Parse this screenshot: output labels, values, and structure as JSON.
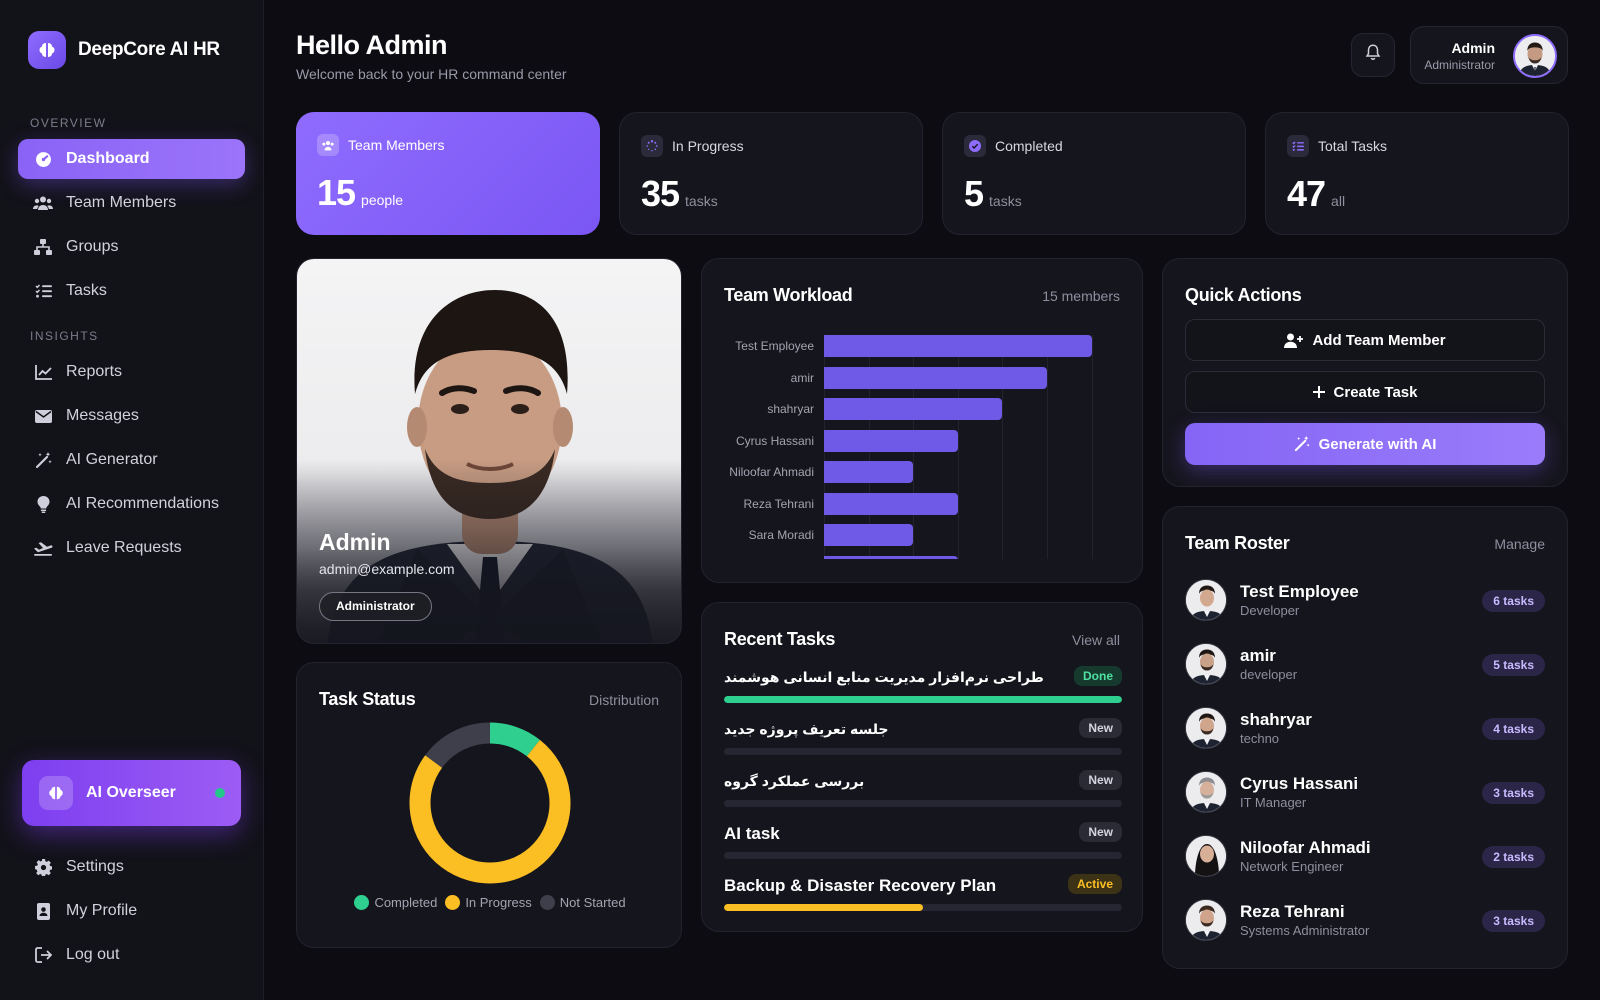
{
  "brand": {
    "name": "DeepCore AI HR"
  },
  "sidebar": {
    "section_overview": "OVERVIEW",
    "section_insights": "INSIGHTS",
    "items": [
      {
        "label": "Dashboard",
        "icon": "dashboard-icon"
      },
      {
        "label": "Team Members",
        "icon": "users-icon"
      },
      {
        "label": "Groups",
        "icon": "sitemap-icon"
      },
      {
        "label": "Tasks",
        "icon": "tasks-icon"
      },
      {
        "label": "Reports",
        "icon": "chart-line-icon"
      },
      {
        "label": "Messages",
        "icon": "envelope-icon"
      },
      {
        "label": "AI Generator",
        "icon": "magic-wand-icon"
      },
      {
        "label": "AI Recommendations",
        "icon": "lightbulb-icon"
      },
      {
        "label": "Leave Requests",
        "icon": "plane-icon"
      }
    ],
    "overseer": {
      "label": "AI Overseer"
    },
    "bottom": [
      {
        "label": "Settings",
        "icon": "gear-icon"
      },
      {
        "label": "My Profile",
        "icon": "id-badge-icon"
      },
      {
        "label": "Log out",
        "icon": "logout-icon"
      }
    ]
  },
  "header": {
    "title": "Hello Admin",
    "subtitle": "Welcome back to your HR command center",
    "user": {
      "name": "Admin",
      "role": "Administrator"
    }
  },
  "stats": [
    {
      "label": "Team Members",
      "value": "15",
      "unit": "people"
    },
    {
      "label": "In Progress",
      "value": "35",
      "unit": "tasks"
    },
    {
      "label": "Completed",
      "value": "5",
      "unit": "tasks"
    },
    {
      "label": "Total Tasks",
      "value": "47",
      "unit": "all"
    }
  ],
  "profile": {
    "name": "Admin",
    "email": "admin@example.com",
    "role": "Administrator"
  },
  "task_status": {
    "title": "Task Status",
    "meta": "Distribution",
    "legend": [
      "Completed",
      "In Progress",
      "Not Started"
    ]
  },
  "workload": {
    "title": "Team Workload",
    "meta": "15 members"
  },
  "recent_tasks": {
    "title": "Recent Tasks",
    "meta": "View all",
    "items": [
      {
        "name": "طراحی نرم‌افزار مدیریت منابع انسانی هوشمند",
        "status": "Done",
        "progress": 1.0
      },
      {
        "name": "جلسه تعریف پروژه جدید",
        "status": "New",
        "progress": 0
      },
      {
        "name": "بررسی عملکرد گروه",
        "status": "New",
        "progress": 0
      },
      {
        "name": "AI task",
        "status": "New",
        "progress": 0
      },
      {
        "name": "Backup & Disaster Recovery Plan",
        "status": "Active",
        "progress": 0.5
      }
    ]
  },
  "quick_actions": {
    "title": "Quick Actions",
    "add_member": "Add Team Member",
    "create_task": "Create Task",
    "generate_ai": "Generate with AI"
  },
  "roster": {
    "title": "Team Roster",
    "meta": "Manage",
    "items": [
      {
        "name": "Test Employee",
        "role": "Developer",
        "tasks": "6 tasks"
      },
      {
        "name": "amir",
        "role": "developer",
        "tasks": "5 tasks"
      },
      {
        "name": "shahryar",
        "role": "techno",
        "tasks": "4 tasks"
      },
      {
        "name": "Cyrus Hassani",
        "role": "IT Manager",
        "tasks": "3 tasks"
      },
      {
        "name": "Niloofar Ahmadi",
        "role": "Network Engineer",
        "tasks": "2 tasks"
      },
      {
        "name": "Reza Tehrani",
        "role": "Systems Administrator",
        "tasks": "3 tasks"
      }
    ]
  },
  "colors": {
    "accent": "#8f6cff",
    "completed": "#2fd08f",
    "in_progress": "#fbbf24",
    "not_started": "#3f3f4c",
    "done_badge_bg": "#163b2e",
    "done_badge_fg": "#4fe0a2",
    "new_badge_bg": "#2b2b36",
    "new_badge_fg": "#d4d4de",
    "active_badge_bg": "#3c3216",
    "active_badge_fg": "#fbbf24"
  },
  "chart_data": [
    {
      "type": "bar",
      "orientation": "horizontal",
      "title": "Team Workload",
      "categories": [
        "Test Employee",
        "amir",
        "shahryar",
        "Cyrus Hassani",
        "Niloofar Ahmadi",
        "Reza Tehrani",
        "Sara Moradi"
      ],
      "values": [
        6,
        5,
        4,
        3,
        2,
        3,
        2
      ],
      "xlim": [
        0,
        6.5
      ]
    },
    {
      "type": "pie",
      "title": "Task Status",
      "categories": [
        "Completed",
        "In Progress",
        "Not Started"
      ],
      "values": [
        5,
        35,
        7
      ]
    }
  ]
}
